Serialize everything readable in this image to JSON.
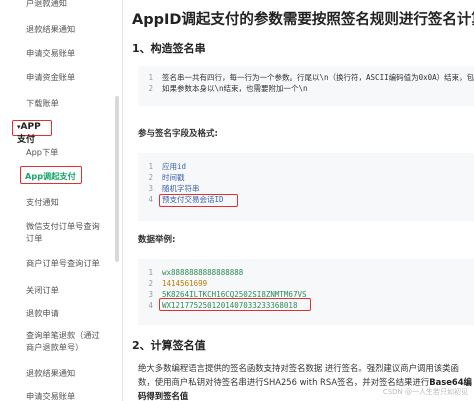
{
  "sidebar": {
    "items": [
      {
        "label": "户退款通知"
      },
      {
        "label": "退款结果通知"
      },
      {
        "label": "申请交易账单"
      },
      {
        "label": "申请资金账单"
      },
      {
        "label": "下载账单"
      }
    ],
    "section_label": "APP支付",
    "sub_items": [
      {
        "label": "App下单"
      },
      {
        "label": "App调起支付"
      },
      {
        "label": "支付通知"
      },
      {
        "label": "微信支付订单号查询订单"
      },
      {
        "label": "商户订单号查询订单"
      },
      {
        "label": "关闭订单"
      },
      {
        "label": "退款申请"
      },
      {
        "label": "查询单笔退款（通过商户退款单号）"
      },
      {
        "label": "退款结果通知"
      },
      {
        "label": "申请交易账单"
      }
    ]
  },
  "main": {
    "title": "AppID调起支付的参数需要按照签名规则进行签名计算",
    "section1": "1、构造签名串",
    "code1": [
      {
        "num": "1",
        "text": "签名串一共有四行，每一行为一个参数。行尾以\\n（换行符，ASCII编码值为0x0A）结束，包括最后一行。"
      },
      {
        "num": "2",
        "text": "如果参数本身以\\n结束，也需要附加一个\\n"
      }
    ],
    "params_heading": "参与签名字段及格式:",
    "code2": [
      {
        "num": "1",
        "text": "应用id"
      },
      {
        "num": "2",
        "text": "时间戳"
      },
      {
        "num": "3",
        "text": "随机字符串"
      },
      {
        "num": "4",
        "text": "预支付交易会话ID"
      }
    ],
    "example_heading": "数据举例:",
    "code3": [
      {
        "num": "1",
        "text": "wx8888888888888888"
      },
      {
        "num": "2",
        "text": "1414561699"
      },
      {
        "num": "3",
        "text": "5K8264ILTKCH16CQ2502SI8ZNMTM67VS"
      },
      {
        "num": "4",
        "text": "WX1217752501201407033233368018"
      }
    ],
    "section2": "2、计算签名值",
    "paragraph_part1": "绝大多数编程语言提供的签名函数支持对签名数据 进行签名。强烈建议商户调用该类函数，使用商户私钥对待签名串进行SHA256 with RSA签名，并对签名结果进行",
    "paragraph_bold": "Base64编码得到签名值",
    "watermark": "CSDN @一人生若只如初见"
  },
  "colors": {
    "highlight_border": "#e03030",
    "active_text": "#1aa36a",
    "code_bg": "#f6f8fa"
  }
}
